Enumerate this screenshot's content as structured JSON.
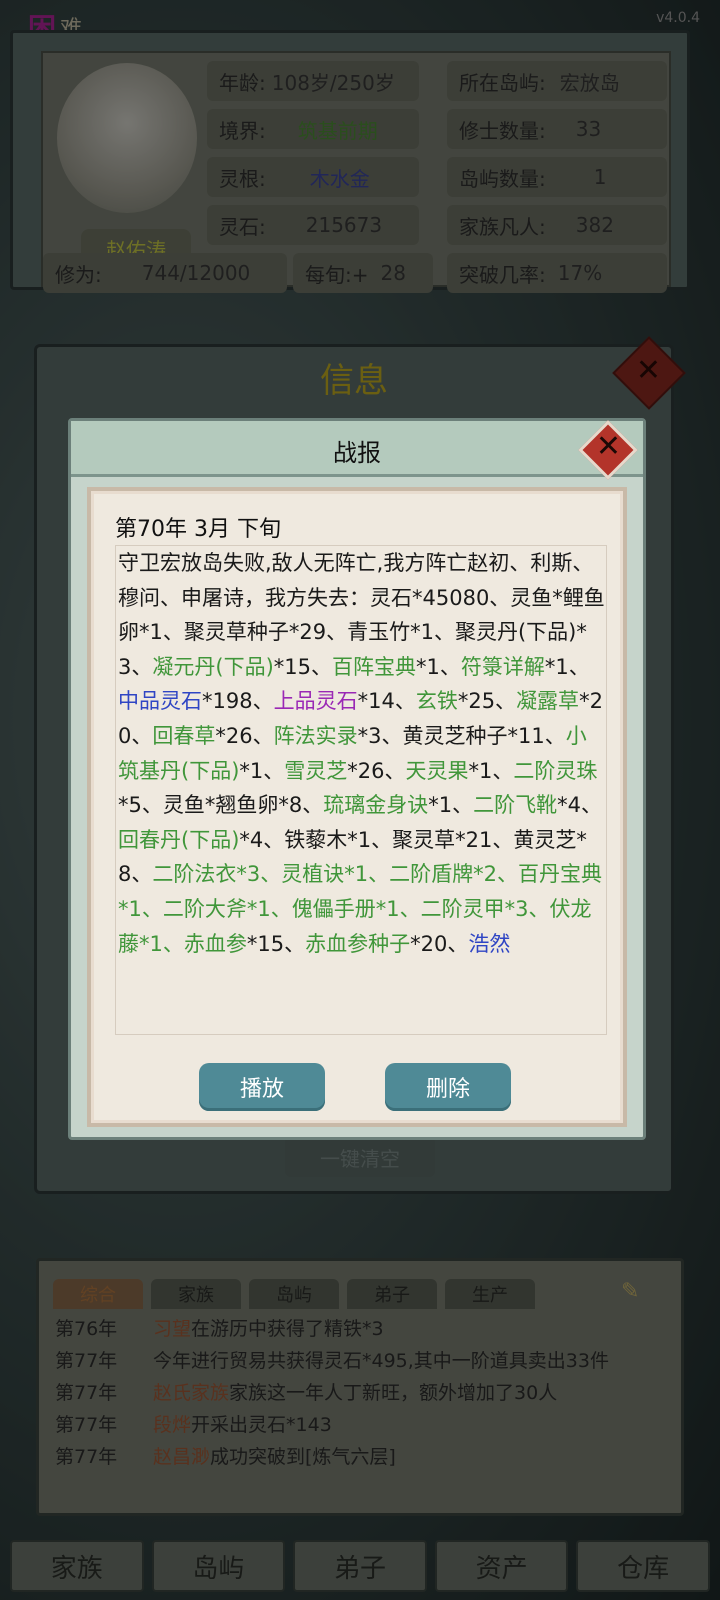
{
  "difficulty": "难",
  "version": "v4.0.4",
  "player": {
    "name": "赵佑涛",
    "age_label": "年龄:",
    "age_value": "108岁/250岁",
    "island_label": "所在岛屿:",
    "island_value": "宏放岛",
    "realm_label": "境界:",
    "realm_value": "筑基前期",
    "cultivators_label": "修士数量:",
    "cultivators_value": "33",
    "root_label": "灵根:",
    "root_value": "木水金",
    "islands_label": "岛屿数量:",
    "islands_value": "1",
    "stones_label": "灵石:",
    "stones_value": "215673",
    "mortals_label": "家族凡人:",
    "mortals_value": "382",
    "cultivation_label": "修为:",
    "cultivation_value": "744/12000",
    "per_turn_label": "每旬:+",
    "per_turn_value": "28",
    "breakthrough_label": "突破几率:",
    "breakthrough_value": "17%"
  },
  "info_window": {
    "title": "信息",
    "clear_all": "一键清空"
  },
  "report": {
    "title": "战报",
    "date": "第70年 3月 下旬",
    "segments": [
      {
        "text": "守卫宏放岛失败,敌人无阵亡,我方阵亡赵初、利斯、穆问、申屠诗，我方失去：灵石*45080、灵鱼*鲤鱼卵*1、聚灵草种子*29、青玉竹*1、聚灵丹(下品)*3、",
        "c": ""
      },
      {
        "text": "凝元丹(下品)",
        "c": "g"
      },
      {
        "text": "*15、",
        "c": ""
      },
      {
        "text": "百阵宝典",
        "c": "g"
      },
      {
        "text": "*1、",
        "c": ""
      },
      {
        "text": "符箓详解",
        "c": "g"
      },
      {
        "text": "*1、",
        "c": ""
      },
      {
        "text": "中品灵石",
        "c": "b"
      },
      {
        "text": "*198、",
        "c": ""
      },
      {
        "text": "上品灵石",
        "c": "p"
      },
      {
        "text": "*14、",
        "c": ""
      },
      {
        "text": "玄铁",
        "c": "g"
      },
      {
        "text": "*25、",
        "c": ""
      },
      {
        "text": "凝露草",
        "c": "g"
      },
      {
        "text": "*20、",
        "c": ""
      },
      {
        "text": "回春草",
        "c": "g"
      },
      {
        "text": "*26、",
        "c": ""
      },
      {
        "text": "阵法实录",
        "c": "g"
      },
      {
        "text": "*3、黄灵芝种子*11、",
        "c": ""
      },
      {
        "text": "小筑基丹(下品)",
        "c": "g"
      },
      {
        "text": "*1、",
        "c": ""
      },
      {
        "text": "雪灵芝",
        "c": "g"
      },
      {
        "text": "*26、",
        "c": ""
      },
      {
        "text": "天灵果",
        "c": "g"
      },
      {
        "text": "*1、",
        "c": ""
      },
      {
        "text": "二阶灵珠",
        "c": "g"
      },
      {
        "text": "*5、灵鱼*翘鱼卵*8、",
        "c": ""
      },
      {
        "text": "琉璃金身诀",
        "c": "g"
      },
      {
        "text": "*1、",
        "c": ""
      },
      {
        "text": "二阶飞靴",
        "c": "g"
      },
      {
        "text": "*4、",
        "c": ""
      },
      {
        "text": "回春丹(下品)",
        "c": "g"
      },
      {
        "text": "*4、铁藜木*1、聚灵草*21、黄灵芝*8、",
        "c": ""
      },
      {
        "text": "二阶法衣*3、灵植诀*1、二阶盾牌*2、百丹宝典*1、二阶大斧*1、傀儡手册*1、二阶灵甲*3、伏龙藤*1、",
        "c": "g"
      },
      {
        "text": "赤血参",
        "c": "g"
      },
      {
        "text": "*15、",
        "c": ""
      },
      {
        "text": "赤血参种子",
        "c": "g"
      },
      {
        "text": "*20、",
        "c": ""
      },
      {
        "text": "浩然",
        "c": "b"
      }
    ],
    "play_button": "播放",
    "delete_button": "删除"
  },
  "log": {
    "tabs": [
      "综合",
      "家族",
      "岛屿",
      "弟子",
      "生产"
    ],
    "entries": [
      {
        "year": "第76年",
        "name": "习望",
        "text": "在游历中获得了精铁*3"
      },
      {
        "year": "第77年",
        "name": "",
        "text": "今年进行贸易共获得灵石*495,其中一阶道具卖出33件"
      },
      {
        "year": "第77年",
        "name": "赵氏家族",
        "text": "家族这一年人丁新旺，额外增加了30人"
      },
      {
        "year": "第77年",
        "name": "段烨",
        "text": "开采出灵石*143"
      },
      {
        "year": "第77年",
        "name": "赵昌渺",
        "text": "成功突破到[炼气六层]"
      }
    ]
  },
  "nav": [
    "家族",
    "岛屿",
    "弟子",
    "资产",
    "仓库"
  ]
}
